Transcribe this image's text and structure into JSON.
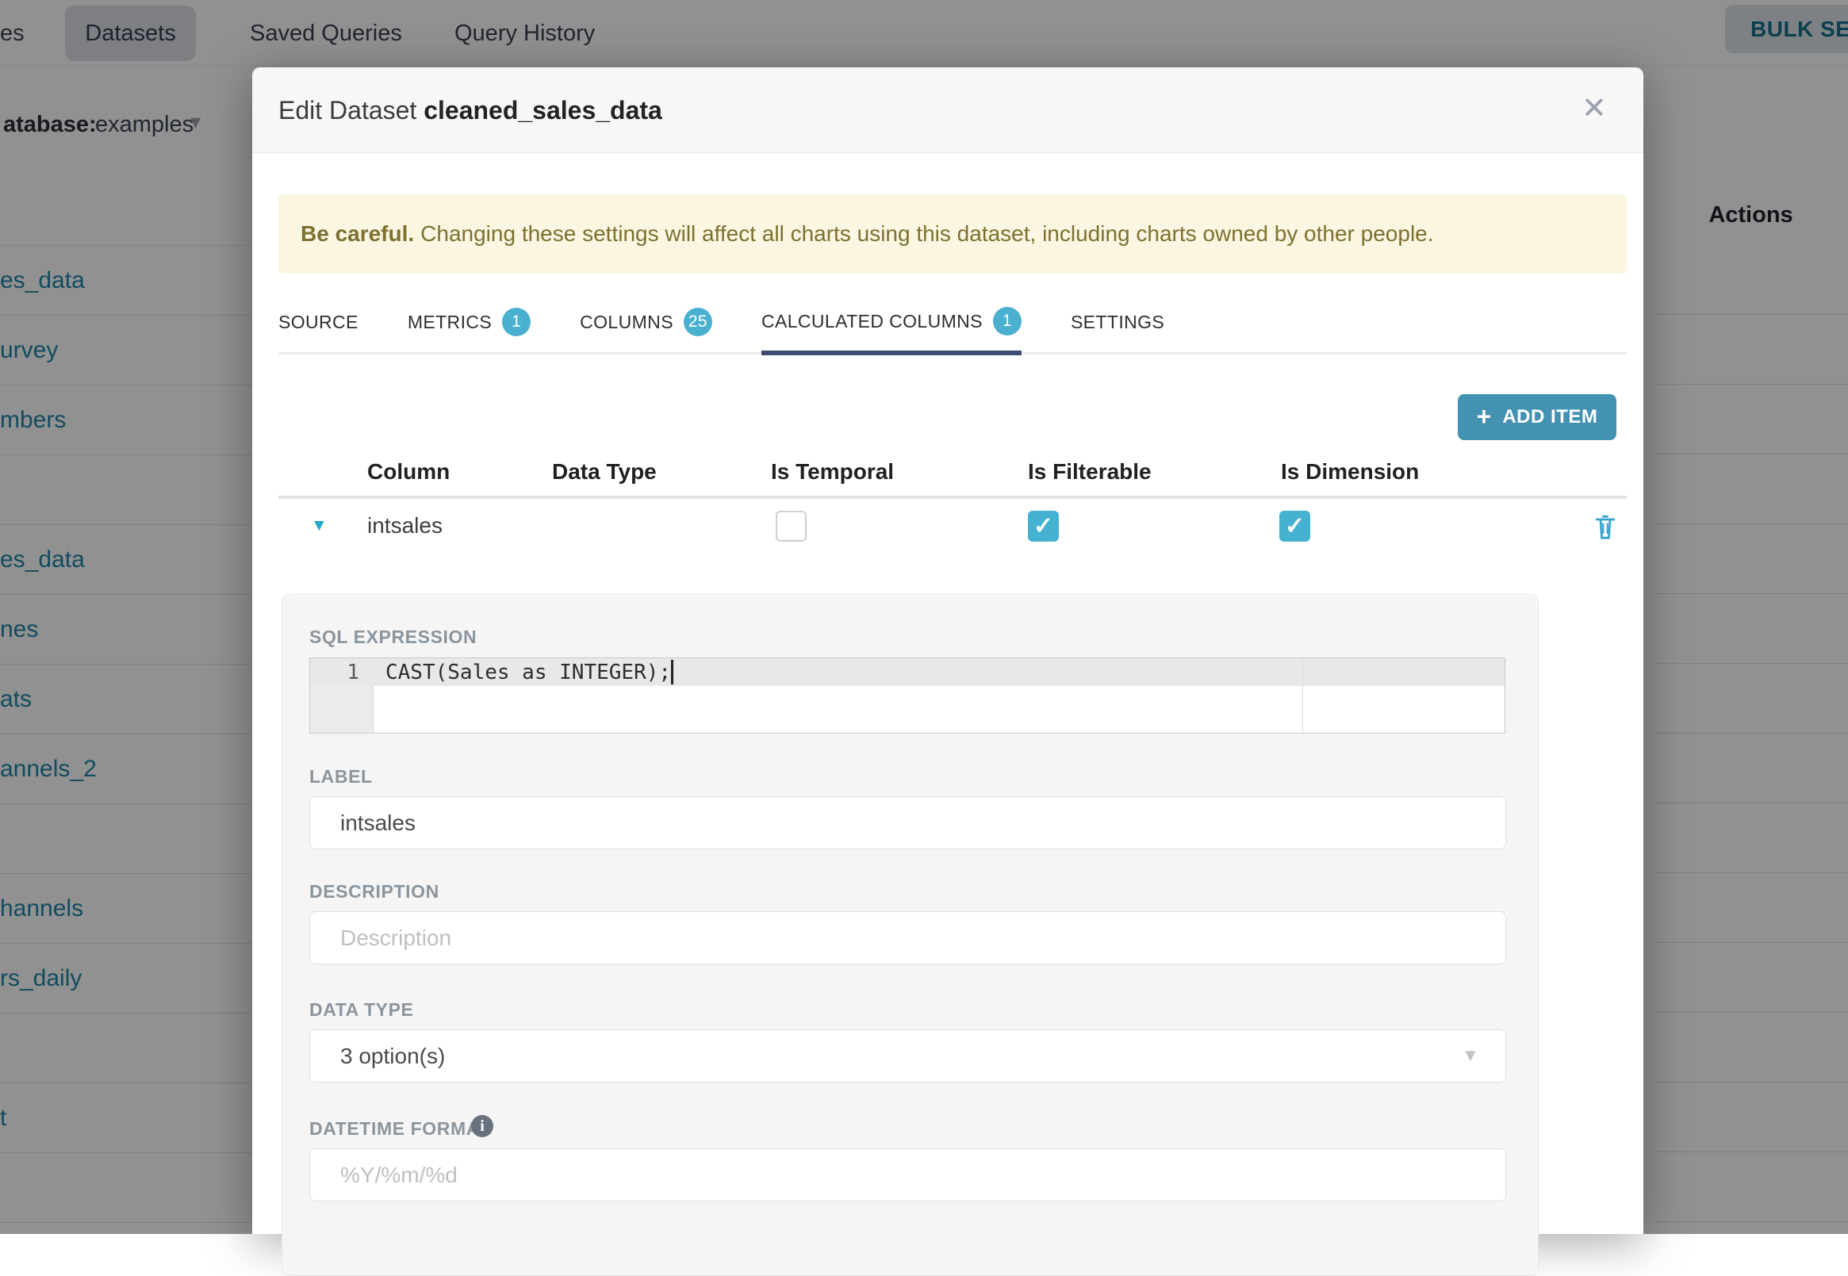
{
  "background": {
    "nav": {
      "left_fragment": "es",
      "datasets_tab": "Datasets",
      "saved_queries_tab": "Saved Queries",
      "query_history_tab": "Query History",
      "bulk_select_label": "BULK SELE"
    },
    "filter": {
      "database_label": "atabase:",
      "database_value": "examples"
    },
    "table": {
      "actions_header": "Actions",
      "row_fragments": [
        "es_data",
        "urvey",
        "mbers",
        "",
        "es_data",
        "nes",
        "ats",
        "annels_2",
        "",
        "hannels",
        "rs_daily",
        "",
        "t",
        ""
      ]
    }
  },
  "modal": {
    "title_prefix": "Edit Dataset ",
    "title_name": "cleaned_sales_data",
    "close_glyph": "✕",
    "warning": {
      "bold": "Be careful.",
      "text": "Changing these settings will affect all charts using this dataset, including charts owned by other people."
    },
    "tabs": [
      {
        "label": "SOURCE"
      },
      {
        "label": "METRICS",
        "badge": "1"
      },
      {
        "label": "COLUMNS",
        "badge": "25"
      },
      {
        "label": "CALCULATED COLUMNS",
        "badge": "1"
      },
      {
        "label": "SETTINGS"
      }
    ],
    "active_tab": "CALCULATED COLUMNS",
    "add_item_label": "ADD ITEM",
    "columns_table": {
      "headers": [
        "Column",
        "Data Type",
        "Is Temporal",
        "Is Filterable",
        "Is Dimension"
      ],
      "rows": [
        {
          "column": "intsales",
          "is_temporal": false,
          "is_filterable": true,
          "is_dimension": true,
          "expanded": true
        }
      ]
    },
    "detail": {
      "sql_label": "SQL EXPRESSION",
      "sql_line_number": "1",
      "sql_code": "CAST(Sales as INTEGER);",
      "label_label": "LABEL",
      "label_value": "intsales",
      "description_label": "DESCRIPTION",
      "description_placeholder": "Description",
      "datatype_label": "DATA TYPE",
      "datatype_value": "3 option(s)",
      "datetime_label": "DATETIME FORMAT",
      "datetime_placeholder": "%Y/%m/%d",
      "info_glyph": "i"
    }
  },
  "colors": {
    "accent_button": "#4492b1",
    "badge": "#4ab0d0",
    "checkbox_checked": "#45b2d2",
    "active_tab_underline": "#3e4b73",
    "warning_bg": "#faf6e1",
    "link": "#1f86a8"
  }
}
